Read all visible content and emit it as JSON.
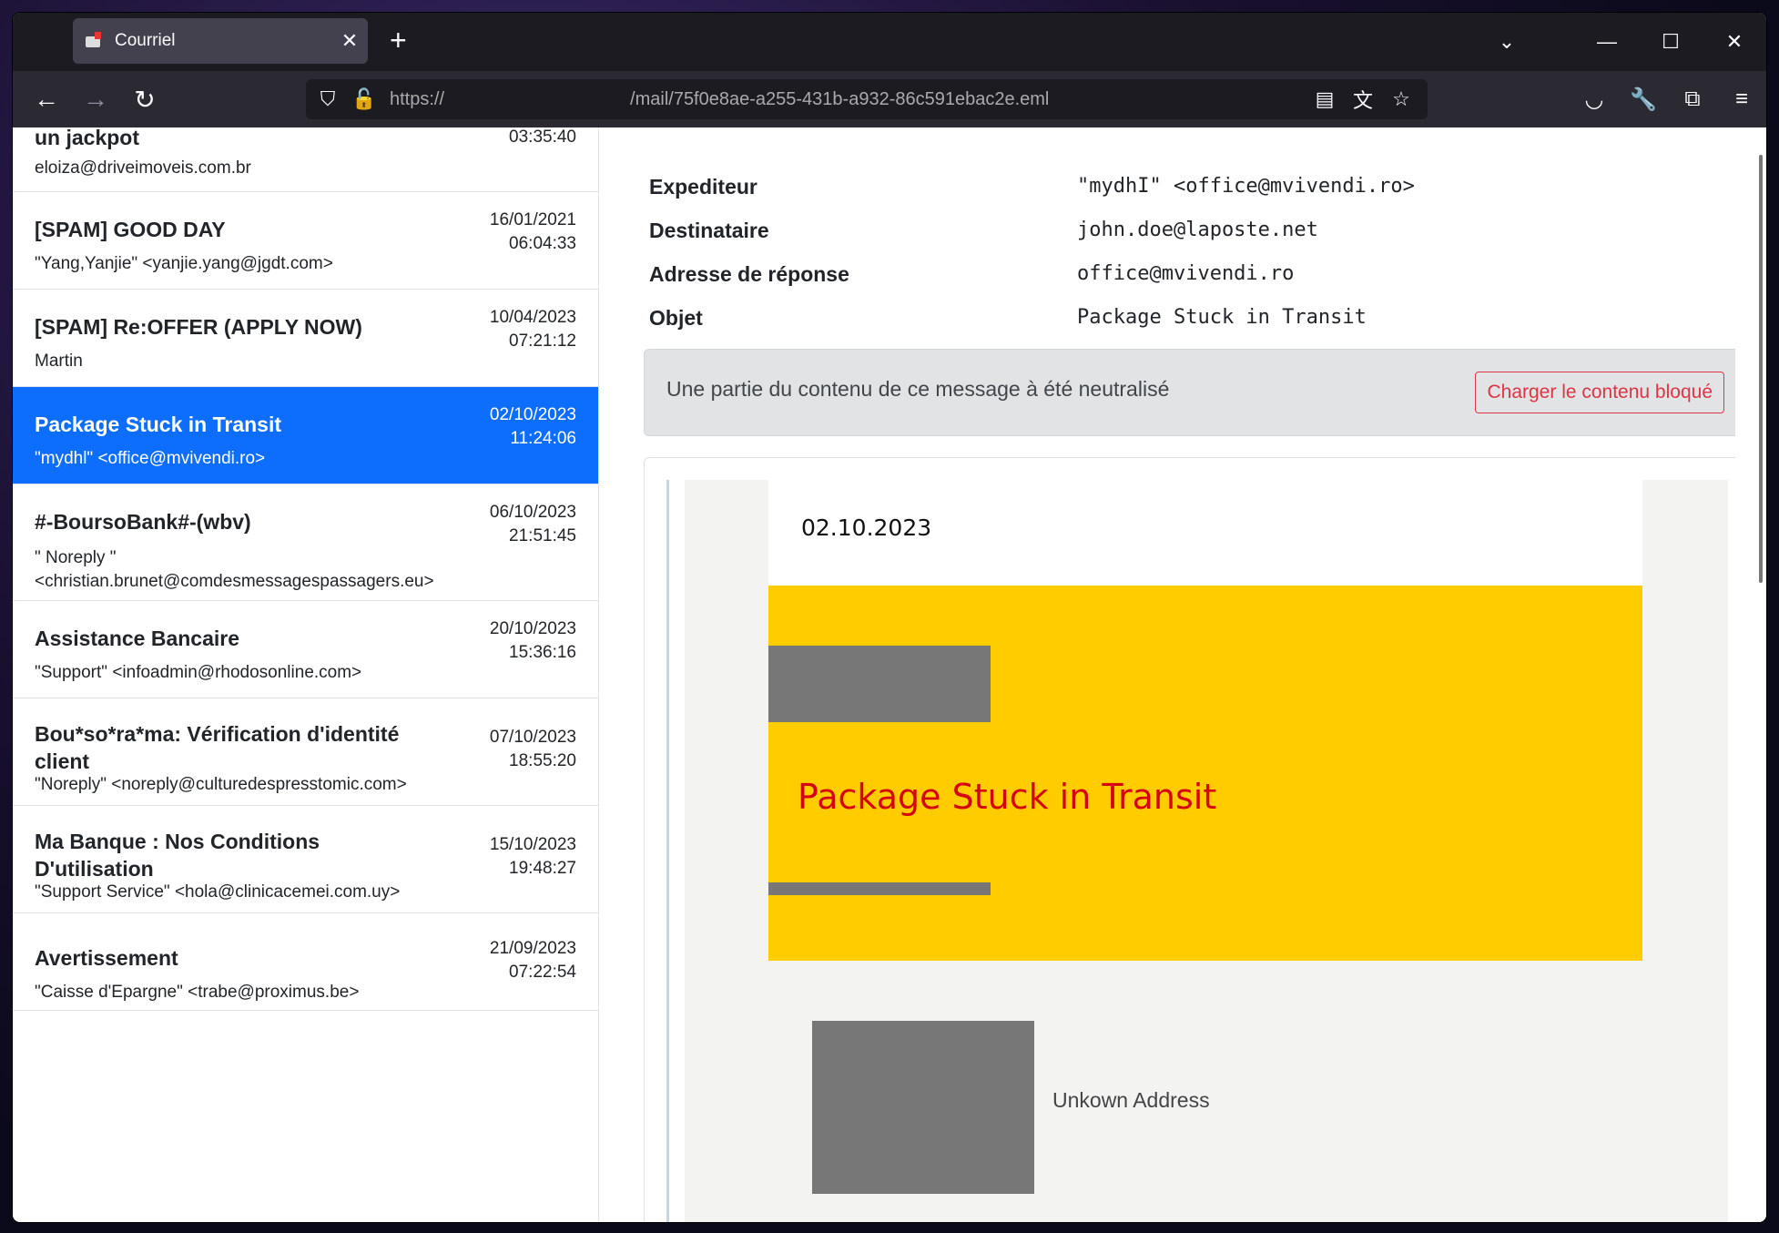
{
  "browser": {
    "tab_title": "Courriel",
    "url_scheme": "https://",
    "url_path": "/mail/75f0e8ae-a255-431b-a932-86c591ebac2e.eml"
  },
  "list": {
    "items": [
      {
        "subject": "un jackpot",
        "from": "eloiza@driveimoveis.com.br",
        "date": "",
        "time": "03:35:40"
      },
      {
        "subject": "[SPAM] GOOD DAY",
        "from": "\"Yang,Yanjie\" <yanjie.yang@jgdt.com>",
        "date": "16/01/2021",
        "time": "06:04:33"
      },
      {
        "subject": "[SPAM] Re:OFFER (APPLY NOW)",
        "from": "Martin",
        "date": "10/04/2023",
        "time": "07:21:12"
      },
      {
        "subject": "Package Stuck in Transit",
        "from": "\"mydhl\" <office@mvivendi.ro>",
        "date": "02/10/2023",
        "time": "11:24:06"
      },
      {
        "subject": "#-BoursoBank#-(wbv)",
        "from": "\" Noreply \" <christian.brunet@comdesmessagespassagers.eu>",
        "date": "06/10/2023",
        "time": "21:51:45"
      },
      {
        "subject": "Assistance Bancaire",
        "from": "\"Support\" <infoadmin@rhodosonline.com>",
        "date": "20/10/2023",
        "time": "15:36:16"
      },
      {
        "subject": "Bou*so*ra*ma: Vérification d'identité client",
        "from": "\"Noreply\" <noreply@culturedespresstomic.com>",
        "date": "07/10/2023",
        "time": "18:55:20"
      },
      {
        "subject": "Ma Banque : Nos Conditions D'utilisation",
        "from": "\"Support Service\" <hola@clinicacemei.com.uy>",
        "date": "15/10/2023",
        "time": "19:48:27"
      },
      {
        "subject": "Avertissement",
        "from": "\"Caisse d'Epargne\" <trabe@proximus.be>",
        "date": "21/09/2023",
        "time": "07:22:54"
      }
    ]
  },
  "headers": {
    "sender_label": "Expediteur",
    "sender_value": "\"mydhI\" <office@mvivendi.ro>",
    "recipient_label": "Destinataire",
    "recipient_value": "john.doe@laposte.net",
    "replyto_label": "Adresse de réponse",
    "replyto_value": "office@mvivendi.ro",
    "subject_label": "Objet",
    "subject_value": "Package Stuck in Transit"
  },
  "alert": {
    "text": "Une partie du contenu de ce message à été neutralisé",
    "button": "Charger le contenu bloqué"
  },
  "body": {
    "date": "02.10.2023",
    "banner_title": "Package Stuck in Transit",
    "address_text": "Unkown Address"
  },
  "colors": {
    "active_item": "#0d6efd",
    "banner": "#ffcc00",
    "banner_title": "#d40511",
    "alert_button": "#dc3545"
  }
}
